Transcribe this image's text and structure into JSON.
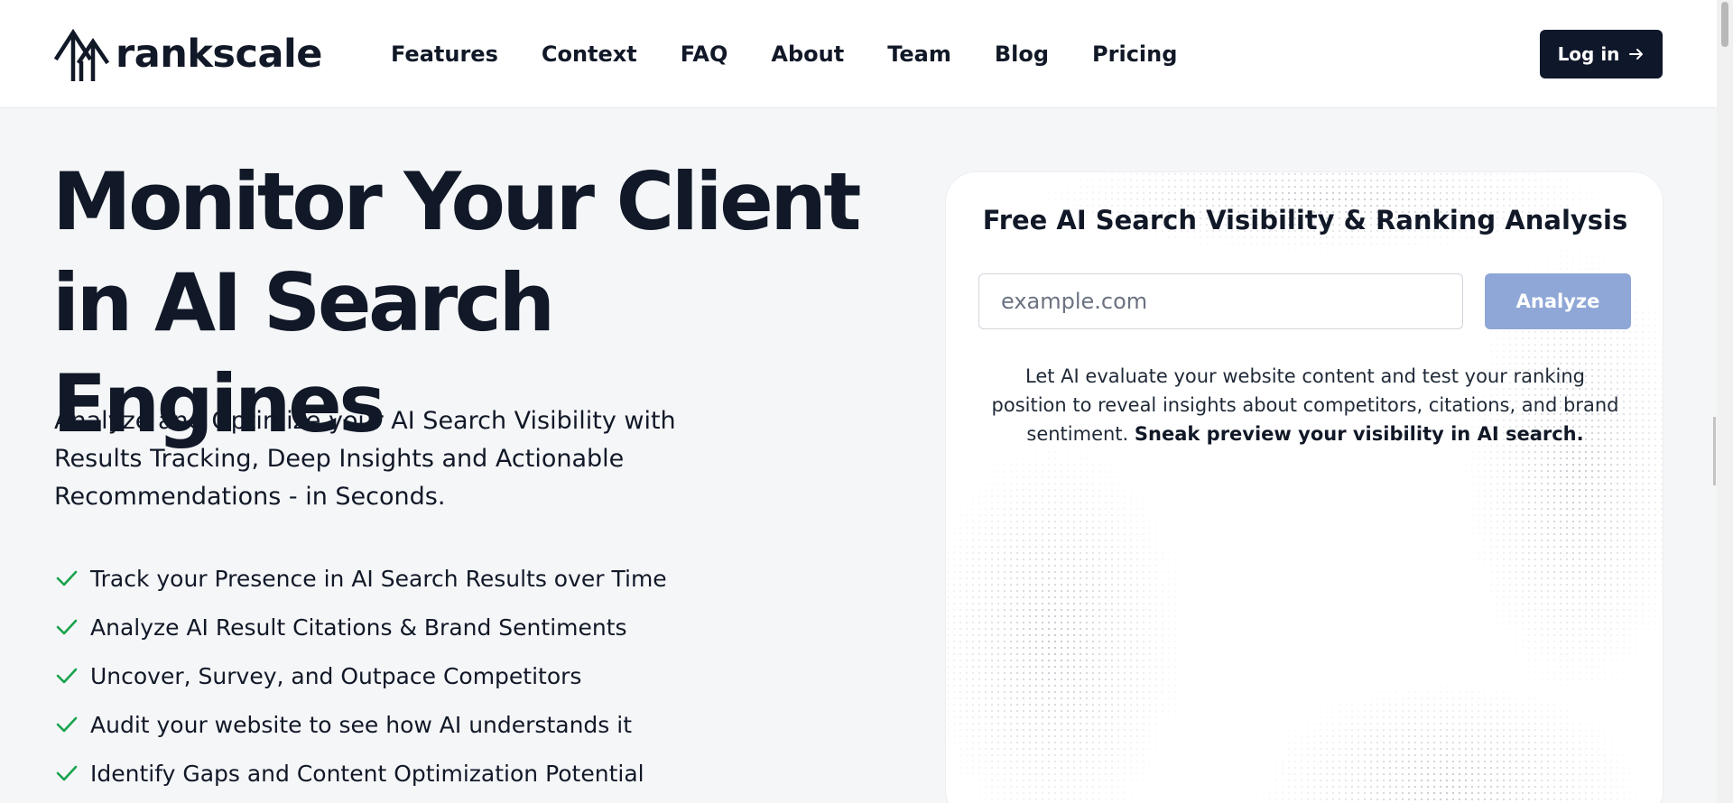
{
  "brand": {
    "name": "rankscale",
    "logo_icon": "rankscale-arrows-logo-icon"
  },
  "nav": {
    "items": [
      {
        "label": "Features"
      },
      {
        "label": "Context"
      },
      {
        "label": "FAQ"
      },
      {
        "label": "About"
      },
      {
        "label": "Team"
      },
      {
        "label": "Blog"
      },
      {
        "label": "Pricing"
      }
    ],
    "login_label": "Log in",
    "login_icon": "arrow-right-icon"
  },
  "hero": {
    "title_line1": "Monitor Your Client",
    "title_line2": "in AI Search Engines",
    "subtitle": "Analyze and Optimize your AI Search Visibility with Results Tracking, Deep Insights and Actionable Recommendations - in Seconds.",
    "features": [
      "Track your Presence in AI Search Results over Time",
      "Analyze AI Result Citations & Brand Sentiments",
      "Uncover, Survey, and Outpace Competitors",
      "Audit your website to see how AI understands it",
      "Identify Gaps and Content Optimization Potential"
    ],
    "feature_icon": "check-icon"
  },
  "analysis_card": {
    "title": "Free AI Search Visibility & Ranking Analysis",
    "input_placeholder": "example.com",
    "input_value": "",
    "button_label": "Analyze",
    "description": "Let AI evaluate your website content and test your ranking position to reveal insights about competitors, citations, and brand sentiment.",
    "description_bold": "Sneak preview your visibility in AI search."
  },
  "colors": {
    "primary_dark": "#0f172a",
    "check_green": "#16a34a",
    "analyze_button": "#8fa7d6",
    "page_bg": "#f5f6f8"
  }
}
